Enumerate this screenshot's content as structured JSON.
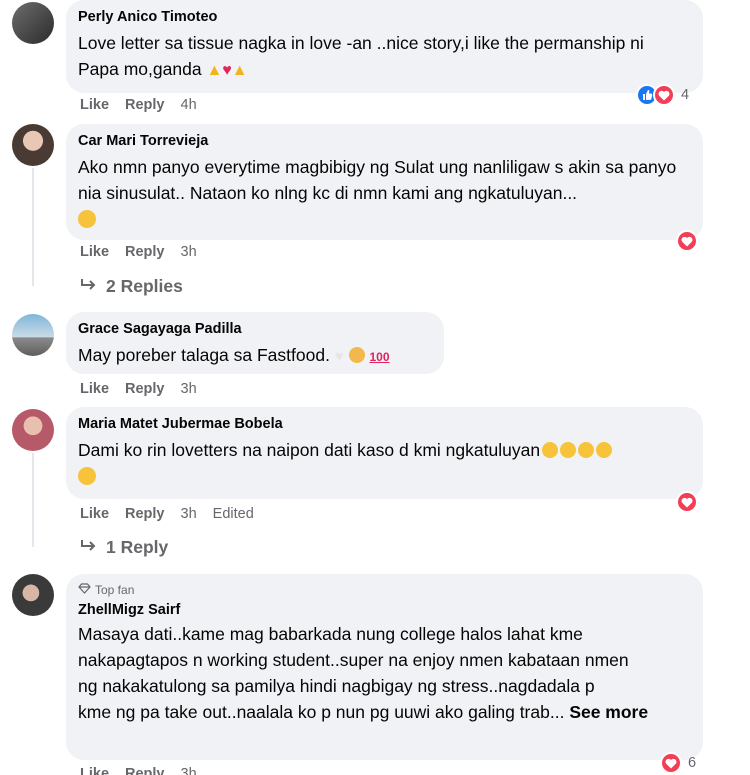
{
  "comments": [
    {
      "author": "Perly Anico Timoteo",
      "text": "Love letter sa tissue nagka in love -an ..nice story,i like the permanship ni Papa mo,ganda",
      "like": "Like",
      "reply": "Reply",
      "time": "4h",
      "reaction_count": "4"
    },
    {
      "author": "Car Mari Torrevieja",
      "text": "Ako nmn panyo everytime magbibigy ng Sulat ung nanliligaw s akin sa panyo nia sinusulat.. Nataon ko nlng kc di nmn kami ang ngkatuluyan...",
      "like": "Like",
      "reply": "Reply",
      "time": "3h",
      "replies": "2 Replies"
    },
    {
      "author": "Grace Sagayaga Padilla",
      "text": "May poreber talaga sa Fastfood.",
      "like": "Like",
      "reply": "Reply",
      "time": "3h"
    },
    {
      "author": "Maria Matet Jubermae Bobela",
      "text": "Dami ko rin lovetters na naipon dati kaso d kmi ngkatuluyan",
      "like": "Like",
      "reply": "Reply",
      "time": "3h",
      "edited": "Edited",
      "replies": "1 Reply"
    },
    {
      "badge": "Top fan",
      "author": "ZhellMigz Sairf",
      "text_lines": [
        "Masaya dati..kame mag babarkada nung college halos lahat kme",
        "nakapagtapos n working student..super na enjoy nmen kabataan nmen",
        "ng nakakatulong sa pamilya hindi nagbigay ng stress..nagdadala p",
        "kme ng pa take out..naalala ko p nun pg uuwi ako galing trab..."
      ],
      "see_more": "See more",
      "like": "Like",
      "reply": "Reply",
      "time": "3h",
      "reaction_count": "6"
    }
  ],
  "colors": {
    "bubble": "#f0f2f5",
    "meta": "#65676b",
    "love": "#f33e58",
    "like": "#1877f2"
  }
}
